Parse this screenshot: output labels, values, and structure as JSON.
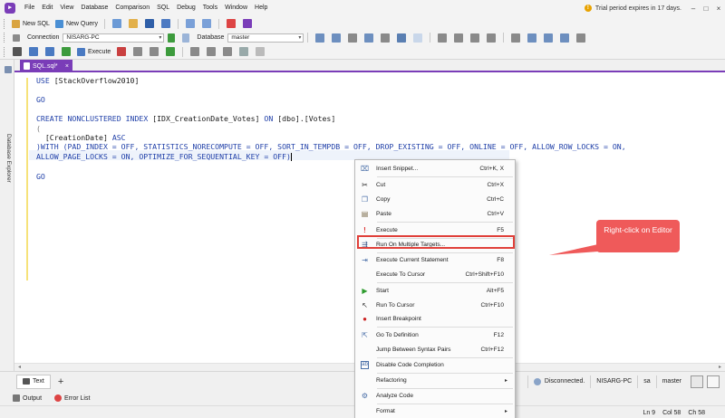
{
  "menubar": {
    "items": [
      "File",
      "Edit",
      "View",
      "Database",
      "Comparison",
      "SQL",
      "Debug",
      "Tools",
      "Window",
      "Help"
    ],
    "trial_notice": "Trial period expires in 17 days."
  },
  "toolbar1": {
    "new_sql": "New SQL",
    "new_query": "New Query"
  },
  "toolbar2": {
    "connection_label": "Connection",
    "connection_value": "NISARG-PC",
    "database_label": "Database",
    "database_value": "master"
  },
  "toolbar3": {
    "execute_label": "Execute"
  },
  "left_dock": {
    "database_explorer": "Database Explorer"
  },
  "document_tab": {
    "title": "SQL.sql*"
  },
  "editor": {
    "lines": [
      {
        "kind": "use",
        "kw": "USE",
        "rest": " [StackOverflow2010]"
      },
      {
        "kind": "go",
        "kw": "GO"
      },
      {
        "kind": "create",
        "kw1": "CREATE",
        "kw2": " NONCLUSTERED",
        "kw3": " INDEX",
        "rest1": " [IDX_CreationDate_Votes] ",
        "kw4": "ON",
        "rest2": " [dbo].[Votes]"
      },
      {
        "kind": "paren_open",
        "text": "("
      },
      {
        "kind": "column",
        "text": "  [CreationDate] ",
        "kw": "ASC"
      },
      {
        "kind": "with1",
        "text": ")WITH (PAD_INDEX = OFF, STATISTICS_NORECOMPUTE = OFF, SORT_IN_TEMPDB = OFF, DROP_EXISTING = OFF, ONLINE = OFF, ALLOW_ROW_LOCKS = ON,"
      },
      {
        "kind": "with2",
        "text": "ALLOW_PAGE_LOCKS = ON, OPTIMIZE_FOR_SEQUENTIAL_KEY = OFF)"
      },
      {
        "kind": "go",
        "kw": "GO"
      }
    ]
  },
  "context_menu": {
    "items": [
      {
        "label": "Insert Snippet...",
        "shortcut": "Ctrl+K, X",
        "icon": "snippet-icon"
      },
      {
        "label": "Cut",
        "shortcut": "Ctrl+X",
        "icon": "cut-icon"
      },
      {
        "label": "Copy",
        "shortcut": "Ctrl+C",
        "icon": "copy-icon"
      },
      {
        "label": "Paste",
        "shortcut": "Ctrl+V",
        "icon": "paste-icon"
      },
      {
        "label": "Execute",
        "shortcut": "F5",
        "icon": "execute-icon"
      },
      {
        "label": "Run On Multiple Targets...",
        "shortcut": "",
        "icon": "multiple-targets-icon"
      },
      {
        "label": "Execute Current Statement",
        "shortcut": "F8",
        "icon": "execute-statement-icon"
      },
      {
        "label": "Execute To Cursor",
        "shortcut": "Ctrl+Shift+F10",
        "icon": ""
      },
      {
        "label": "Start",
        "shortcut": "Alt+F5",
        "icon": "start-icon"
      },
      {
        "label": "Run To Cursor",
        "shortcut": "Ctrl+F10",
        "icon": "run-to-cursor-icon"
      },
      {
        "label": "Insert Breakpoint",
        "shortcut": "",
        "icon": "breakpoint-icon"
      },
      {
        "label": "Go To Definition",
        "shortcut": "F12",
        "icon": "definition-icon"
      },
      {
        "label": "Jump Between Syntax Pairs",
        "shortcut": "Ctrl+F12",
        "icon": ""
      },
      {
        "label": "Disable Code Completion",
        "shortcut": "",
        "icon": "code-completion-icon"
      },
      {
        "label": "Refactoring",
        "shortcut": "",
        "icon": ""
      },
      {
        "label": "Analyze Code",
        "shortcut": "",
        "icon": "analyze-icon"
      },
      {
        "label": "Format",
        "shortcut": "",
        "icon": ""
      }
    ]
  },
  "callout": {
    "text": "Right-click on Editor"
  },
  "bottom_tabs": {
    "text_tab": "Text",
    "add_tab": "+"
  },
  "status": {
    "connection_state": "Disconnected.",
    "server": "NISARG-PC",
    "user": "sa",
    "database": "master",
    "line": "Ln 9",
    "col": "Col 58",
    "ch": "Ch 58"
  },
  "output_tabs": {
    "output": "Output",
    "error_list": "Error List"
  },
  "colors": {
    "accent": "#7a3db8",
    "keyword": "#1f3fa8",
    "callout": "#ef5a5a",
    "highlight_border": "#e0403a"
  }
}
